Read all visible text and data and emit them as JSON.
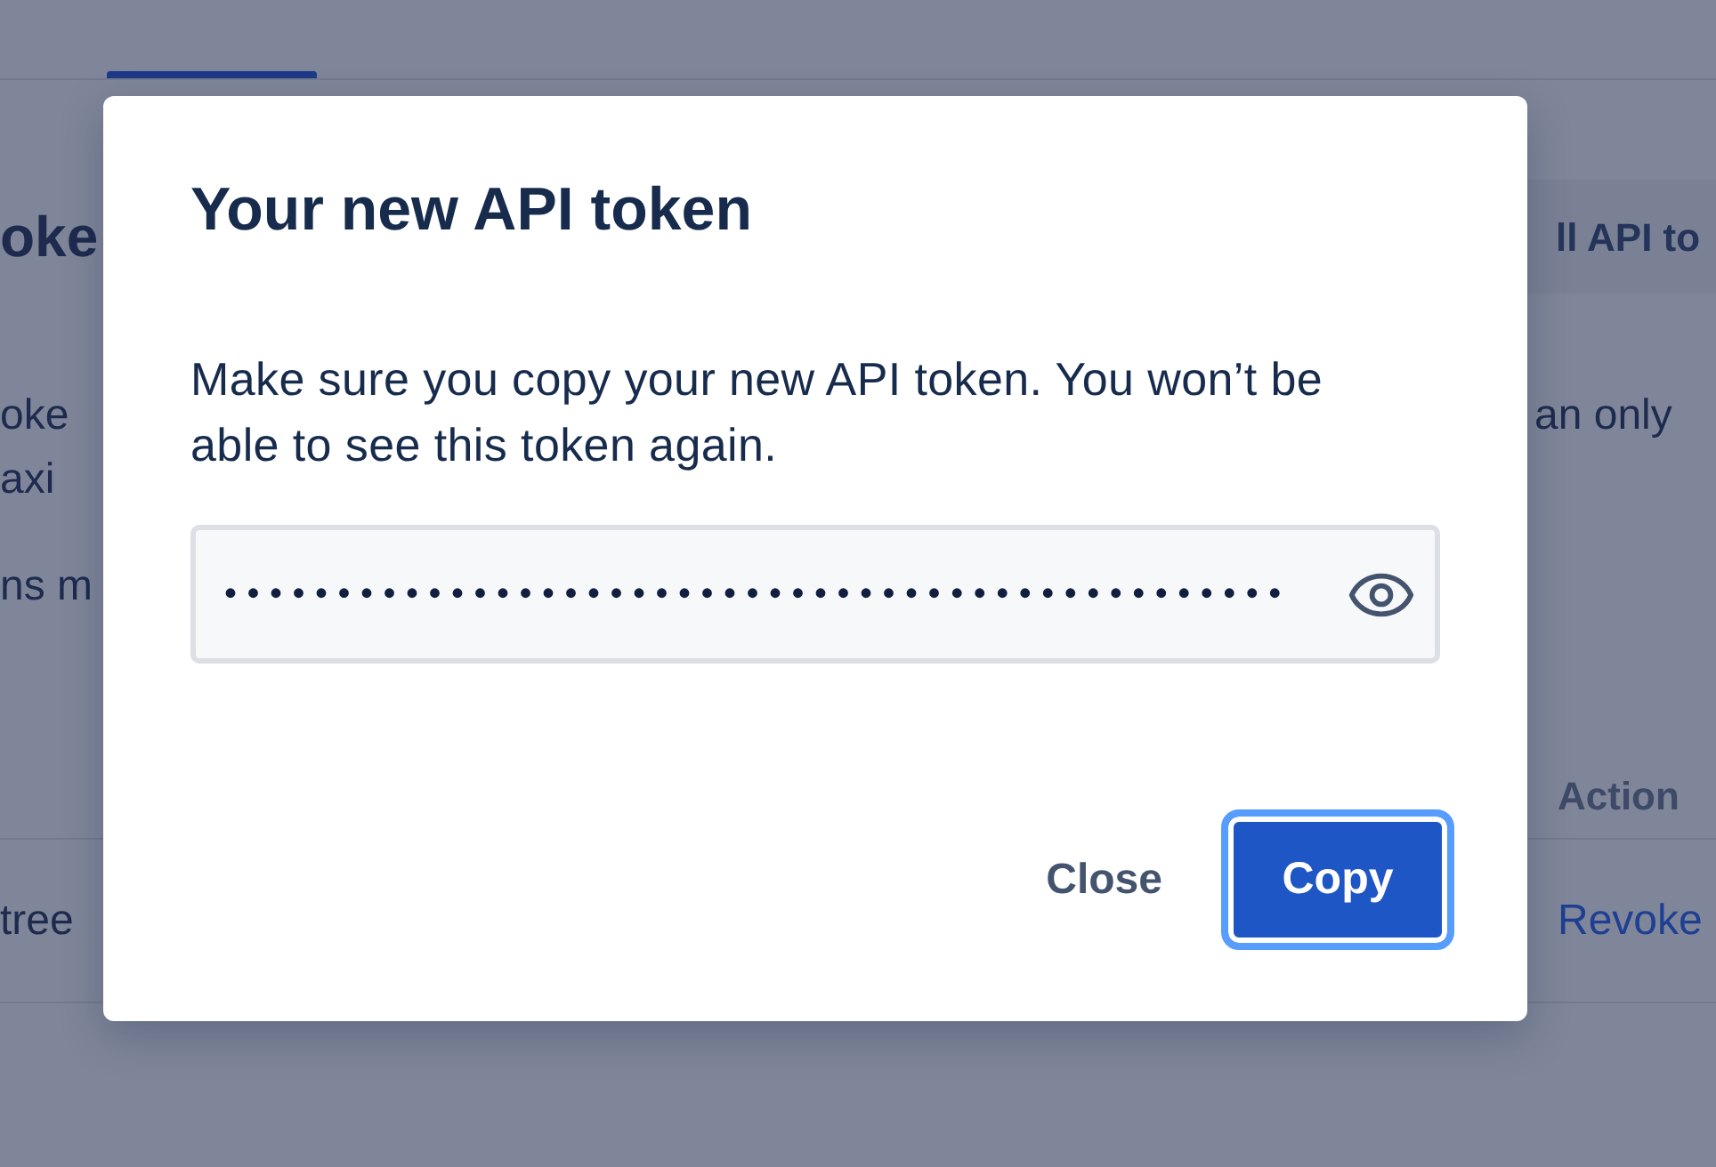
{
  "background_page": {
    "heading": "oke",
    "header_button": "ll API to",
    "paragraph_lines": [
      {
        "left": "oke",
        "right": "an only"
      },
      {
        "left": "axi"
      }
    ],
    "note": "ns m",
    "table": {
      "columns": [
        {
          "label": "Action"
        }
      ],
      "rows": [
        {
          "column_1": "tree",
          "action": "Revoke"
        }
      ]
    }
  },
  "dialog": {
    "title": "Your new API token",
    "message": "Make sure you copy your new API token. You won’t be able to see this token again.",
    "token_field": {
      "value": "•••••••••••••••••••••••••••••••••••••••••••••••"
    },
    "buttons": [
      {
        "label": "Close",
        "kind": "subtle",
        "focused": false
      },
      {
        "label": "Copy",
        "kind": "primary",
        "focused": true
      }
    ]
  }
}
